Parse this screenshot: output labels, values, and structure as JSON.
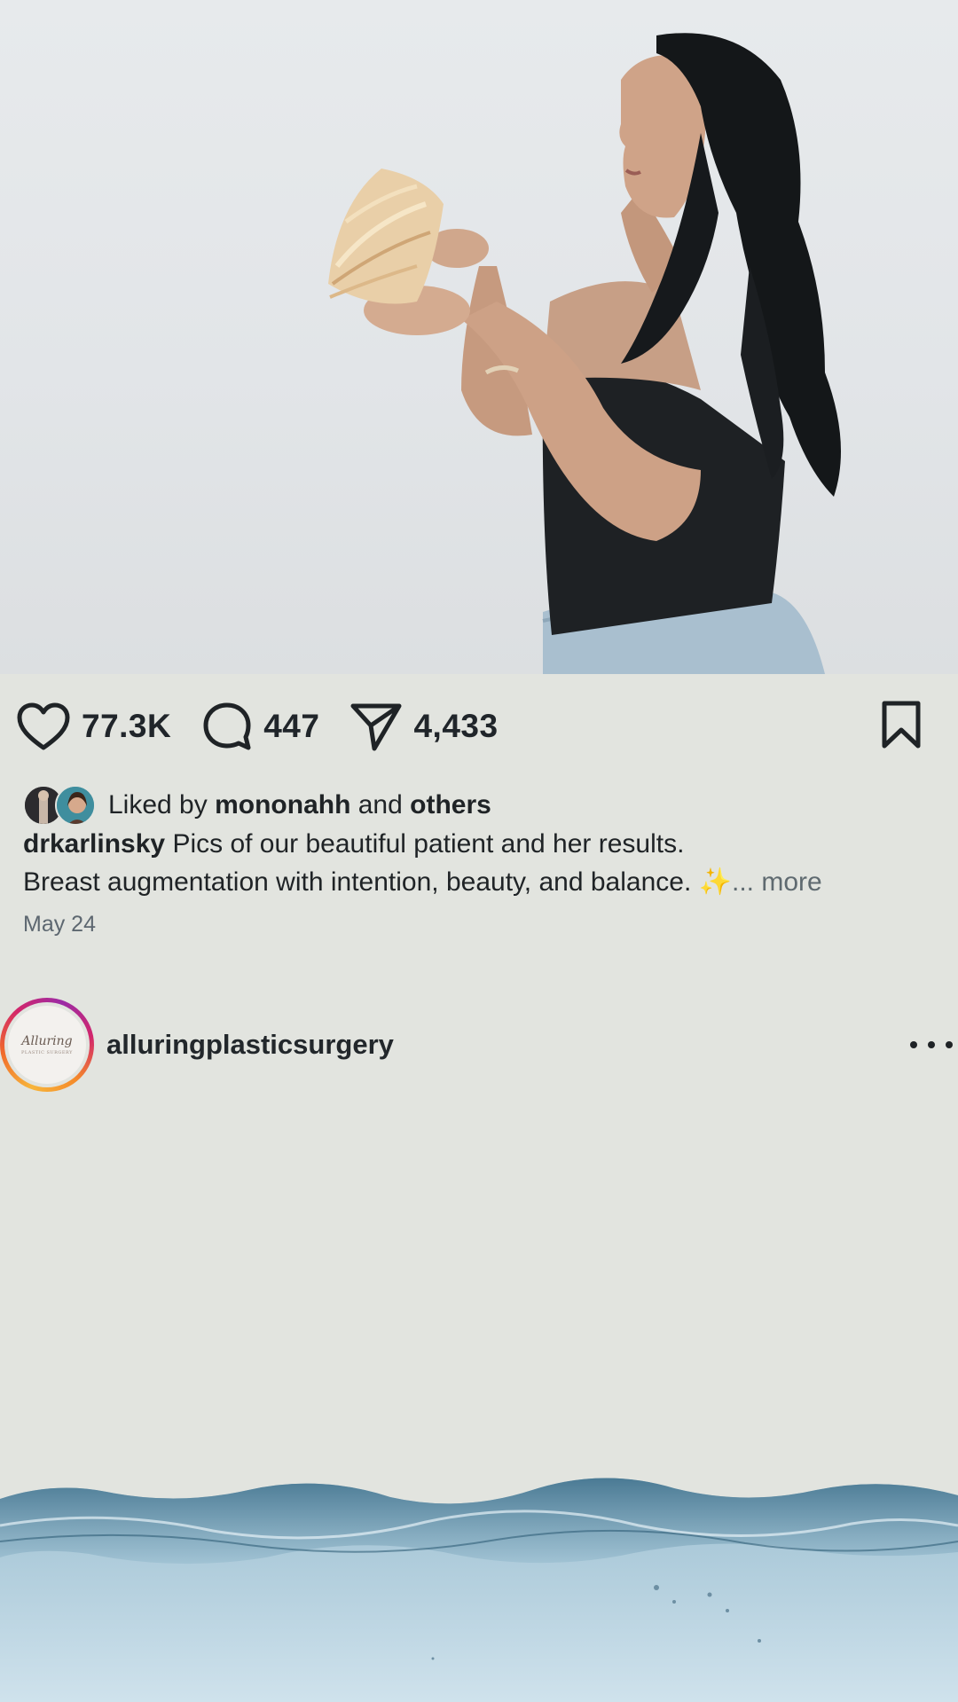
{
  "post": {
    "actions": {
      "likes": "77.3K",
      "comments": "447",
      "shares": "4,433"
    },
    "liked_by": {
      "prefix": "Liked by",
      "user": "mononahh",
      "conjunction": "and",
      "others": "others"
    },
    "caption": {
      "author": "drkarlinsky",
      "line1": "Pics of our beautiful patient and her results.",
      "line2": "Breast augmentation with intention, beauty, and balance.",
      "emoji": "✨",
      "more": "... more"
    },
    "date": "May 24"
  },
  "next_post": {
    "username": "alluringplasticsurgery",
    "logo_text": "Alluring",
    "logo_subtext": "PLASTIC SURGERY"
  },
  "icons": {
    "like": "heart-icon",
    "comment": "comment-icon",
    "share": "paper-plane-icon",
    "save": "bookmark-icon",
    "menu": "more-dots-icon"
  },
  "colors": {
    "background": "#e2e4df",
    "text": "#1f2326",
    "muted": "#5f6a70",
    "story_ring": [
      "#f7b53b",
      "#d2266b",
      "#9b2ba6"
    ]
  }
}
